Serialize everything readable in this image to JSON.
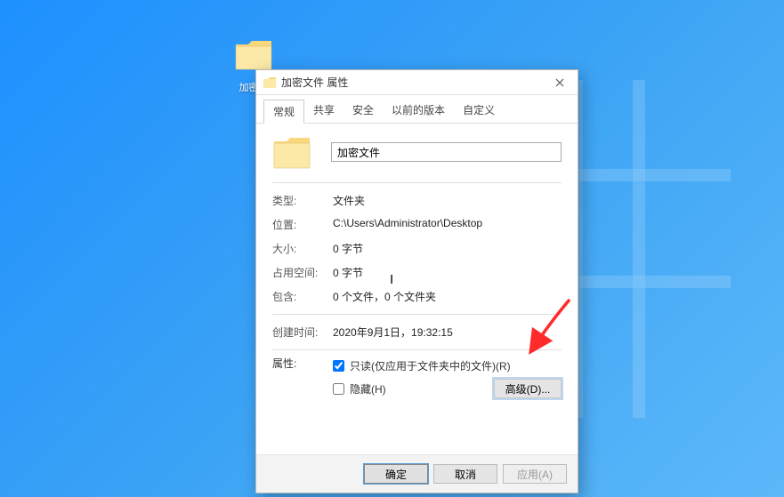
{
  "desktop": {
    "icon_label": "加密文"
  },
  "dialog": {
    "title": "加密文件 属性",
    "tabs": [
      "常规",
      "共享",
      "安全",
      "以前的版本",
      "自定义"
    ],
    "active_tab": 0,
    "folder_name": "加密文件",
    "fields": {
      "type_label": "类型:",
      "type_value": "文件夹",
      "location_label": "位置:",
      "location_value": "C:\\Users\\Administrator\\Desktop",
      "size_label": "大小:",
      "size_value": "0 字节",
      "ondisk_label": "占用空间:",
      "ondisk_value": "0 字节",
      "contains_label": "包含:",
      "contains_value": "0 个文件，0 个文件夹",
      "created_label": "创建时间:",
      "created_value": "2020年9月1日，19:32:15",
      "attributes_label": "属性:",
      "readonly_label": "只读(仅应用于文件夹中的文件)(R)",
      "readonly_checked": true,
      "hidden_label": "隐藏(H)",
      "hidden_checked": false,
      "advanced_button": "高级(D)..."
    },
    "buttons": {
      "ok": "确定",
      "cancel": "取消",
      "apply": "应用(A)"
    }
  }
}
